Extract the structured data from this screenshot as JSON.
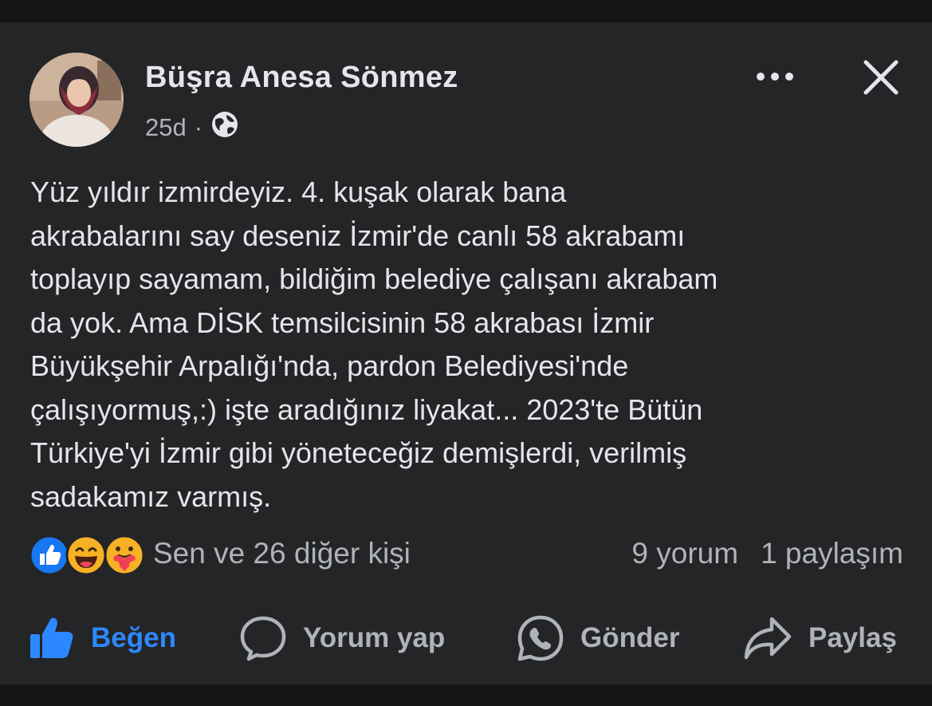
{
  "post": {
    "author": "Büşra Anesa Sönmez",
    "time": "25d",
    "separator": "·",
    "audience_icon": "globe-icon",
    "body": "Yüz yıldır izmirdeyiz. 4. kuşak olarak bana\nakrabalarını say deseniz İzmir'de canlı 58 akrabamı\ntoplayıp sayamam, bildiğim belediye çalışanı akrabam\nda yok. Ama DİSK temsilcisinin 58 akrabası İzmir\nBüyükşehir Arpalığı'nda, pardon Belediyesi'nde\nçalışıyormuş,:) işte aradığınız liyakat... 2023'te Bütün\nTürkiye'yi İzmir gibi yöneteceğiz demişlerdi, verilmiş\nsadakamız varmış."
  },
  "reactions": {
    "icons": [
      "like-icon",
      "laugh-icon",
      "care-icon"
    ],
    "summary": "Sen ve 26 diğer kişi",
    "comments": "9 yorum",
    "shares": "1 paylaşım"
  },
  "actions": {
    "like": "Beğen",
    "comment": "Yorum yap",
    "send": "Gönder",
    "share": "Paylaş"
  },
  "colors": {
    "background": "#242526",
    "text": "#e4e6eb",
    "secondary": "#b0b3b8",
    "accent": "#2d88ff"
  }
}
